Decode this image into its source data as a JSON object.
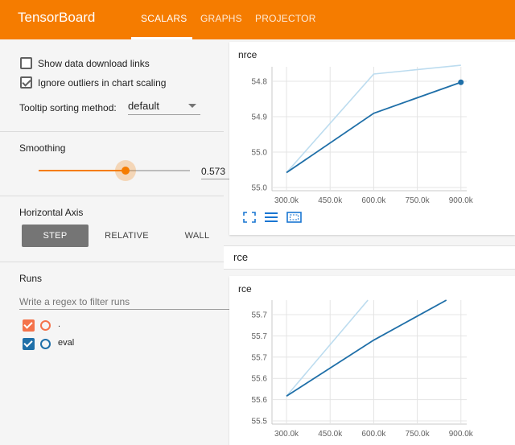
{
  "header": {
    "brand": "TensorBoard",
    "tabs": [
      {
        "label": "SCALARS",
        "active": true
      },
      {
        "label": "GRAPHS",
        "active": false
      },
      {
        "label": "PROJECTOR",
        "active": false
      }
    ]
  },
  "sidebar": {
    "options": {
      "show_download": {
        "label": "Show data download links",
        "checked": false
      },
      "ignore_outliers": {
        "label": "Ignore outliers in chart scaling",
        "checked": true
      },
      "tooltip_label": "Tooltip sorting method:",
      "tooltip_value": "default"
    },
    "smoothing": {
      "title": "Smoothing",
      "value": "0.573",
      "level": 0.573
    },
    "horizontal_axis": {
      "title": "Horizontal Axis",
      "buttons": [
        "STEP",
        "RELATIVE",
        "WALL"
      ],
      "selected": "STEP"
    },
    "runs": {
      "title": "Runs",
      "filter_placeholder": "Write a regex to filter runs",
      "items": [
        {
          "label": ".",
          "color": "#f4734b",
          "checked": true
        },
        {
          "label": "eval",
          "color": "#1f77b4",
          "checked": true
        }
      ]
    }
  },
  "main": {
    "group_title": "rce",
    "icons": [
      "fullscreen-icon",
      "data-toggle-icon",
      "fit-domain-icon"
    ]
  },
  "chart_data": [
    {
      "type": "line",
      "title": "nrce",
      "x_ticks": [
        "300.0k",
        "450.0k",
        "600.0k",
        "750.0k",
        "900.0k"
      ],
      "y_ticks": [
        "54.8",
        "54.9",
        "55.0",
        "55.0"
      ],
      "xlim": [
        250000,
        920000
      ],
      "ylim": [
        54.78,
        55.02
      ],
      "series": [
        {
          "color": "#bcdcef",
          "x": [
            300000,
            600000,
            900000
          ],
          "y": [
            54.815,
            55.006,
            55.023
          ]
        },
        {
          "color": "#1f6fa8",
          "x": [
            300000,
            600000,
            900000
          ],
          "y": [
            54.815,
            54.93,
            54.99
          ]
        }
      ],
      "marker": {
        "x": 900000,
        "y": 54.99
      }
    },
    {
      "type": "line",
      "title": "rce",
      "x_ticks": [
        "300.0k",
        "450.0k",
        "600.0k",
        "750.0k",
        "900.0k"
      ],
      "y_ticks": [
        "55.7",
        "55.7",
        "55.7",
        "55.6",
        "55.6",
        "55.5"
      ],
      "xlim": [
        250000,
        920000
      ],
      "ylim": [
        55.52,
        55.675
      ],
      "series": [
        {
          "color": "#bcdcef",
          "x": [
            300000,
            580000
          ],
          "y": [
            55.555,
            55.675
          ]
        },
        {
          "color": "#1f6fa8",
          "x": [
            300000,
            600000,
            850000
          ],
          "y": [
            55.555,
            55.625,
            55.675
          ]
        }
      ]
    }
  ]
}
